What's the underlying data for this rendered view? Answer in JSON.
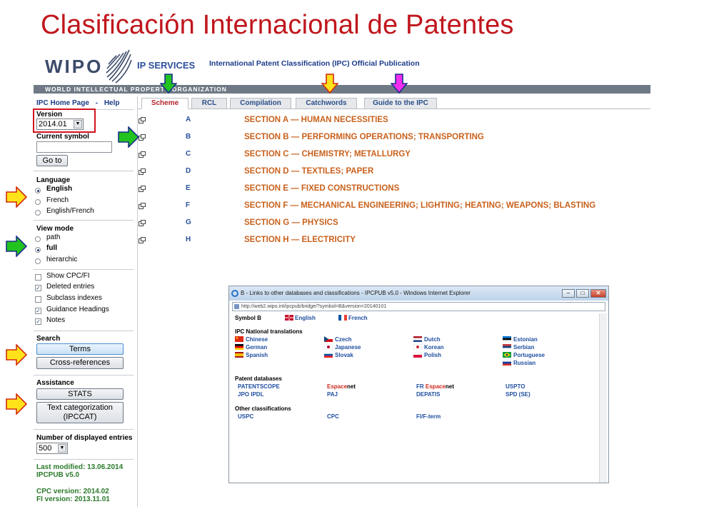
{
  "slide_title": "Clasificación Internacional de Patentes",
  "header": {
    "logo": "WIPO",
    "service": "IP SERVICES",
    "publication": "International Patent Classification (IPC) Official Publication",
    "org": "WORLD INTELLECTUAL PROPERTY ORGANIZATION"
  },
  "tabs": [
    {
      "label": "Scheme",
      "active": true
    },
    {
      "label": "RCL"
    },
    {
      "label": "Compilation"
    },
    {
      "label": "Catchwords"
    },
    {
      "label": "Guide to the IPC"
    }
  ],
  "left": {
    "home": "IPC Home Page",
    "dash": "-",
    "help": "Help",
    "version_label": "Version",
    "version_value": "2014.01",
    "current_symbol_label": "Current symbol",
    "goto": "Go to",
    "language_label": "Language",
    "languages": [
      "English",
      "French",
      "English/French"
    ],
    "viewmode_label": "View mode",
    "viewmodes": [
      "path",
      "full",
      "hierarchic"
    ],
    "checks": [
      "Show CPC/FI",
      "Deleted entries",
      "Subclass indexes",
      "Guidance Headings",
      "Notes"
    ],
    "search_label": "Search",
    "terms": "Terms",
    "crossref": "Cross-references",
    "assistance_label": "Assistance",
    "stats": "STATS",
    "ipccat_line1": "Text categorization",
    "ipccat_line2": "(IPCCAT)",
    "entries_label": "Number of displayed entries",
    "entries_value": "500",
    "last_modified": "Last modified: 13.06.2014",
    "ipcpub": "IPCPUB v5.0",
    "cpc_version": "CPC version: 2014.02",
    "fi_version": "FI version: 2013.11.01"
  },
  "sections": [
    {
      "letter": "A",
      "title": "SECTION A — HUMAN NECESSITIES"
    },
    {
      "letter": "B",
      "title": "SECTION B — PERFORMING OPERATIONS; TRANSPORTING"
    },
    {
      "letter": "C",
      "title": "SECTION C — CHEMISTRY; METALLURGY"
    },
    {
      "letter": "D",
      "title": "SECTION D — TEXTILES; PAPER"
    },
    {
      "letter": "E",
      "title": "SECTION E — FIXED CONSTRUCTIONS"
    },
    {
      "letter": "F",
      "title": "SECTION F — MECHANICAL ENGINEERING; LIGHTING; HEATING; WEAPONS; BLASTING"
    },
    {
      "letter": "G",
      "title": "SECTION G — PHYSICS"
    },
    {
      "letter": "H",
      "title": "SECTION H — ELECTRICITY"
    }
  ],
  "popup": {
    "title": "B - Links to other databases and classifications - IPCPUB v5.0 - Windows Internet Explorer",
    "url": "http://web2.wipo.int/ipcpub/bridge/?symbol=B&version=20140101",
    "symbol": "Symbol B",
    "lang_en": "English",
    "lang_fr": "French",
    "nat_label": "IPC National translations",
    "translations": [
      "Chinese",
      "German",
      "Spanish",
      "Czech",
      "Japanese",
      "Slovak",
      "Dutch",
      "Korean",
      "Polish",
      "Estonian",
      "Serbian",
      "Portuguese",
      "Russian"
    ],
    "patent_db_label": "Patent databases",
    "dbs": [
      "PATENTSCOPE",
      "JPO IPDL",
      "Espace",
      "net",
      "PAJ",
      "FR ",
      "Espace",
      "net",
      "DEPATIS",
      "USPTO",
      "SPD (SE)"
    ],
    "other_label": "Other classifications",
    "others": [
      "USPC",
      "CPC",
      "FI/F-term"
    ]
  }
}
